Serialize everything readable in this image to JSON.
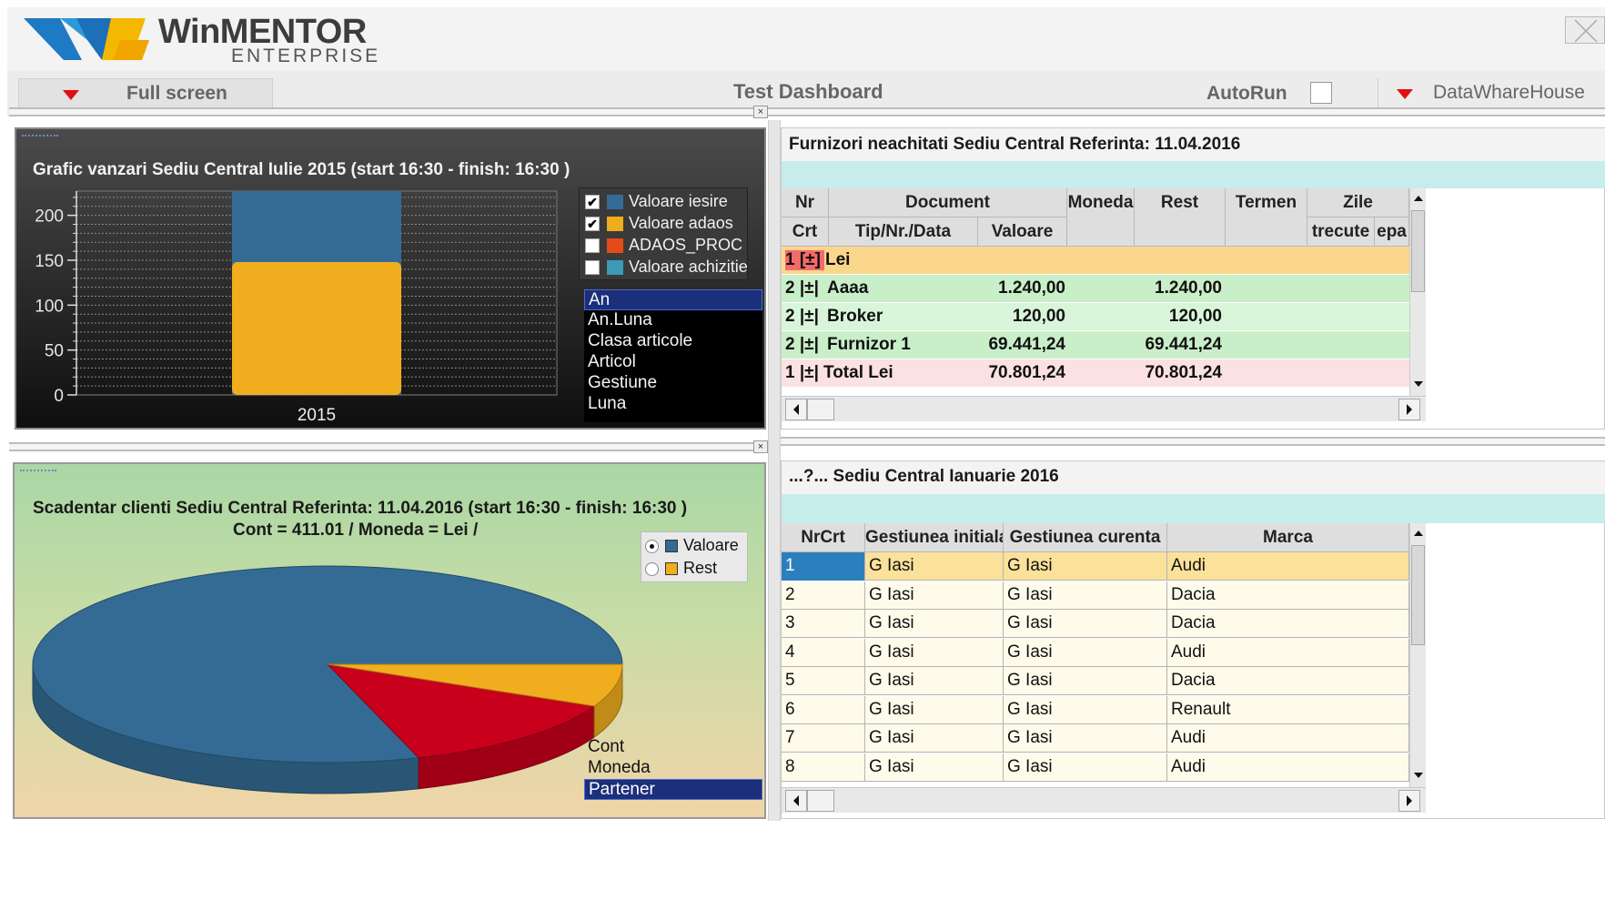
{
  "app": {
    "brand_main": "WinMENTOR",
    "brand_sub": "ENTERPRISE",
    "close_label": "×"
  },
  "toolbar": {
    "fullscreen_label": "Full screen",
    "dashboard_title": "Test Dashboard",
    "autorun_label": "AutoRun",
    "autorun_checked": false,
    "datasource_label": "DataWhareHouse"
  },
  "colors": {
    "accent_red": "#e01010",
    "series_iesire": "#346b94",
    "series_adaos": "#f0ae1e",
    "series_adaos_proc": "#e64a19",
    "series_achizitie": "#3a9ab8",
    "row_group": "#fad78c",
    "row_green": "#c9efc9",
    "row_total": "#fbe1e1",
    "selection": "#1b2f7a"
  },
  "sales_chart": {
    "title": "Grafic vanzari  Sediu Central  Iulie 2015 (start 16:30 - finish:  16:30 )",
    "legend": [
      {
        "label": "Valoare iesire",
        "checked": true,
        "color": "#346b94"
      },
      {
        "label": "Valoare adaos",
        "checked": true,
        "color": "#f0ae1e"
      },
      {
        "label": "ADAOS_PROC",
        "checked": false,
        "color": "#e64a19"
      },
      {
        "label": "Valoare achizitie",
        "checked": false,
        "color": "#3a9ab8"
      }
    ],
    "axis_options": [
      "An",
      "An.Luna",
      "Clasa articole",
      "Articol",
      "Gestiune",
      "Luna"
    ],
    "axis_selected": "An"
  },
  "suppliers": {
    "title": "Furnizori neachitati  Sediu Central Referinta: 11.04.2016",
    "headers": {
      "nr": "Nr",
      "crt": "Crt",
      "document": "Document",
      "tip": "Tip/Nr./Data",
      "valoare": "Valoare",
      "moneda": "Moneda",
      "rest": "Rest",
      "termen": "Termen",
      "zile": "Zile",
      "trecute": "trecute",
      "epa": "epa"
    },
    "rows": [
      {
        "level": "1",
        "toggle": "[±]",
        "name": "Lei",
        "valoare": "",
        "rest": ""
      },
      {
        "level": "2",
        "toggle": "|±|",
        "name": "Aaaa",
        "valoare": "1.240,00",
        "rest": "1.240,00"
      },
      {
        "level": "2",
        "toggle": "|±|",
        "name": "Broker",
        "valoare": "120,00",
        "rest": "120,00"
      },
      {
        "level": "2",
        "toggle": "|±|",
        "name": "Furnizor 1",
        "valoare": "69.441,24",
        "rest": "69.441,24"
      },
      {
        "level": "1",
        "toggle": "|±|",
        "name": "Total Lei",
        "valoare": "70.801,24",
        "rest": "70.801,24"
      }
    ]
  },
  "receivables": {
    "title": "Scadentar clienti  Sediu Central Referinta: 11.04.2016 (start 16:30 - finish:  16:30 )",
    "subtitle": "Cont = 411.01 / Moneda = Lei /",
    "legend": [
      {
        "label": "Valoare",
        "selected": true,
        "color": "#346b94"
      },
      {
        "label": "Rest",
        "selected": false,
        "color": "#f0ae1e"
      }
    ],
    "axis_options": [
      "Cont",
      "Moneda",
      "Partener"
    ],
    "axis_selected": "Partener"
  },
  "stock": {
    "title": "...?...  Sediu Central  Ianuarie 2016",
    "headers": [
      "NrCrt",
      "Gestiunea initiala",
      "Gestiunea curenta",
      "Marca"
    ],
    "rows": [
      [
        "1",
        "G Iasi",
        "G Iasi",
        "Audi"
      ],
      [
        "2",
        "G Iasi",
        "G Iasi",
        "Dacia"
      ],
      [
        "3",
        "G Iasi",
        "G Iasi",
        "Dacia"
      ],
      [
        "4",
        "G Iasi",
        "G Iasi",
        "Audi"
      ],
      [
        "5",
        "G Iasi",
        "G Iasi",
        "Dacia"
      ],
      [
        "6",
        "G Iasi",
        "G Iasi",
        "Renault"
      ],
      [
        "7",
        "G Iasi",
        "G Iasi",
        "Audi"
      ],
      [
        "8",
        "G Iasi",
        "G Iasi",
        "Audi"
      ]
    ]
  },
  "chart_data": [
    {
      "type": "bar",
      "title": "Grafic vanzari  Sediu Central  Iulie 2015 (start 16:30 - finish:  16:30 )",
      "categories": [
        "2015"
      ],
      "stacked": true,
      "series": [
        {
          "name": "Valoare adaos",
          "values": [
            148
          ]
        },
        {
          "name": "Valoare iesire",
          "values": [
            227
          ]
        }
      ],
      "ylim": [
        0,
        227
      ],
      "yticks": [
        0,
        50,
        100,
        150,
        200
      ],
      "grid": true,
      "legend": "top-right"
    },
    {
      "type": "pie",
      "title": "Scadentar clienti  Sediu Central Referinta: 11.04.2016 (start 16:30 - finish:  16:30 )",
      "series_name": "Valoare",
      "slices": [
        {
          "label": "",
          "color": "#346b94",
          "value": 0.8
        },
        {
          "label": "",
          "color": "#c8001c",
          "value": 0.13
        },
        {
          "label": "",
          "color": "#f0ae1e",
          "value": 0.07
        }
      ],
      "legend": "top-right"
    }
  ]
}
